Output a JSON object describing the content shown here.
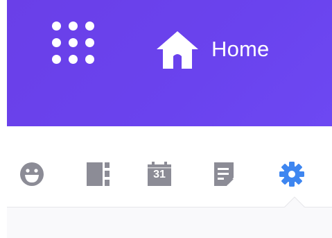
{
  "header": {
    "apps_icon": "apps-grid-icon",
    "home_icon": "home-icon",
    "home_label": "Home",
    "background_color": "#6a43ee"
  },
  "toolbar": {
    "items": [
      {
        "icon": "emoji-icon"
      },
      {
        "icon": "panel-layout-icon"
      },
      {
        "icon": "calendar-icon",
        "text": "31"
      },
      {
        "icon": "notes-icon"
      },
      {
        "icon": "gear-icon",
        "active": true
      }
    ],
    "icon_color": "#8c8c96",
    "active_color": "#3e86f0"
  }
}
